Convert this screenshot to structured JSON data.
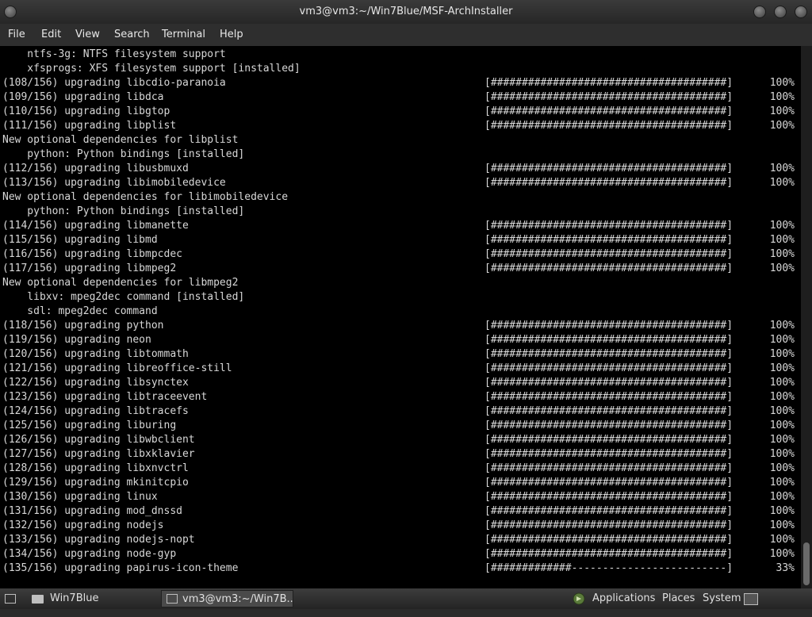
{
  "window": {
    "title": "vm3@vm3:~/Win7Blue/MSF-ArchInstaller"
  },
  "menu": {
    "items": [
      "File",
      "Edit",
      "View",
      "Search",
      "Terminal",
      "Help"
    ]
  },
  "terminal": {
    "header_lines": [
      "    ntfs-3g: NTFS filesystem support",
      "    xfsprogs: XFS filesystem support [installed]"
    ],
    "entries": [
      {
        "text": "(108/156) upgrading libcdio-paranoia",
        "bar": "[######################################]",
        "pct": "100%"
      },
      {
        "text": "(109/156) upgrading libdca",
        "bar": "[######################################]",
        "pct": "100%"
      },
      {
        "text": "(110/156) upgrading libgtop",
        "bar": "[######################################]",
        "pct": "100%"
      },
      {
        "text": "(111/156) upgrading libplist",
        "bar": "[######################################]",
        "pct": "100%"
      },
      {
        "text": "New optional dependencies for libplist"
      },
      {
        "text": "    python: Python bindings [installed]"
      },
      {
        "text": "(112/156) upgrading libusbmuxd",
        "bar": "[######################################]",
        "pct": "100%"
      },
      {
        "text": "(113/156) upgrading libimobiledevice",
        "bar": "[######################################]",
        "pct": "100%"
      },
      {
        "text": "New optional dependencies for libimobiledevice"
      },
      {
        "text": "    python: Python bindings [installed]"
      },
      {
        "text": "(114/156) upgrading libmanette",
        "bar": "[######################################]",
        "pct": "100%"
      },
      {
        "text": "(115/156) upgrading libmd",
        "bar": "[######################################]",
        "pct": "100%"
      },
      {
        "text": "(116/156) upgrading libmpcdec",
        "bar": "[######################################]",
        "pct": "100%"
      },
      {
        "text": "(117/156) upgrading libmpeg2",
        "bar": "[######################################]",
        "pct": "100%"
      },
      {
        "text": "New optional dependencies for libmpeg2"
      },
      {
        "text": "    libxv: mpeg2dec command [installed]"
      },
      {
        "text": "    sdl: mpeg2dec command"
      },
      {
        "text": "(118/156) upgrading python",
        "bar": "[######################################]",
        "pct": "100%"
      },
      {
        "text": "(119/156) upgrading neon",
        "bar": "[######################################]",
        "pct": "100%"
      },
      {
        "text": "(120/156) upgrading libtommath",
        "bar": "[######################################]",
        "pct": "100%"
      },
      {
        "text": "(121/156) upgrading libreoffice-still",
        "bar": "[######################################]",
        "pct": "100%"
      },
      {
        "text": "(122/156) upgrading libsynctex",
        "bar": "[######################################]",
        "pct": "100%"
      },
      {
        "text": "(123/156) upgrading libtraceevent",
        "bar": "[######################################]",
        "pct": "100%"
      },
      {
        "text": "(124/156) upgrading libtracefs",
        "bar": "[######################################]",
        "pct": "100%"
      },
      {
        "text": "(125/156) upgrading liburing",
        "bar": "[######################################]",
        "pct": "100%"
      },
      {
        "text": "(126/156) upgrading libwbclient",
        "bar": "[######################################]",
        "pct": "100%"
      },
      {
        "text": "(127/156) upgrading libxklavier",
        "bar": "[######################################]",
        "pct": "100%"
      },
      {
        "text": "(128/156) upgrading libxnvctrl",
        "bar": "[######################################]",
        "pct": "100%"
      },
      {
        "text": "(129/156) upgrading mkinitcpio",
        "bar": "[######################################]",
        "pct": "100%"
      },
      {
        "text": "(130/156) upgrading linux",
        "bar": "[######################################]",
        "pct": "100%"
      },
      {
        "text": "(131/156) upgrading mod_dnssd",
        "bar": "[######################################]",
        "pct": "100%"
      },
      {
        "text": "(132/156) upgrading nodejs",
        "bar": "[######################################]",
        "pct": "100%"
      },
      {
        "text": "(133/156) upgrading nodejs-nopt",
        "bar": "[######################################]",
        "pct": "100%"
      },
      {
        "text": "(134/156) upgrading node-gyp",
        "bar": "[######################################]",
        "pct": "100%"
      },
      {
        "text": "(135/156) upgrading papirus-icon-theme",
        "bar": "[#############-------------------------]",
        "pct": "33%"
      }
    ]
  },
  "taskbar": {
    "workspace_label": "Win7Blue",
    "task_label": "vm3@vm3:~/Win7B...",
    "menus": [
      "Applications",
      "Places",
      "System"
    ]
  },
  "icons": {
    "window_buttons": [
      "minimize-icon",
      "maximize-icon",
      "close-icon"
    ],
    "taskbar": [
      "show-desktop-icon",
      "folder-icon",
      "terminal-icon",
      "applications-menu-icon",
      "system-terminal-icon"
    ]
  }
}
